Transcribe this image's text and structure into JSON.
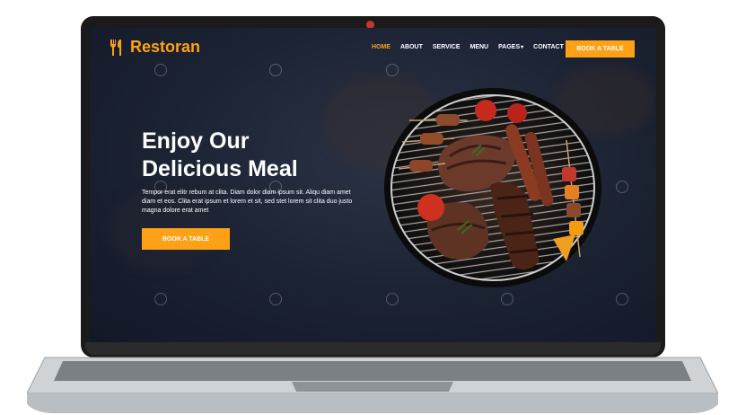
{
  "brand": {
    "name": "Restoran"
  },
  "nav": {
    "items": [
      "HOME",
      "ABOUT",
      "SERVICE",
      "MENU",
      "PAGES",
      "CONTACT"
    ],
    "book_label": "BOOK A TABLE"
  },
  "hero": {
    "title_line1": "Enjoy Our",
    "title_line2": "Delicious Meal",
    "text": "Tempor erat elitr rebum at clita. Diam dolor diam ipsum sit. Aliqu diam amet diam et eos. Clita erat ipsum et lorem et sit, sed stet lorem sit clita duo justo magna dolore erat amet",
    "button_label": "BOOK A TABLE"
  },
  "colors": {
    "accent": "#fea116",
    "bg": "#1b2232",
    "frame": "#1a1a1a"
  }
}
